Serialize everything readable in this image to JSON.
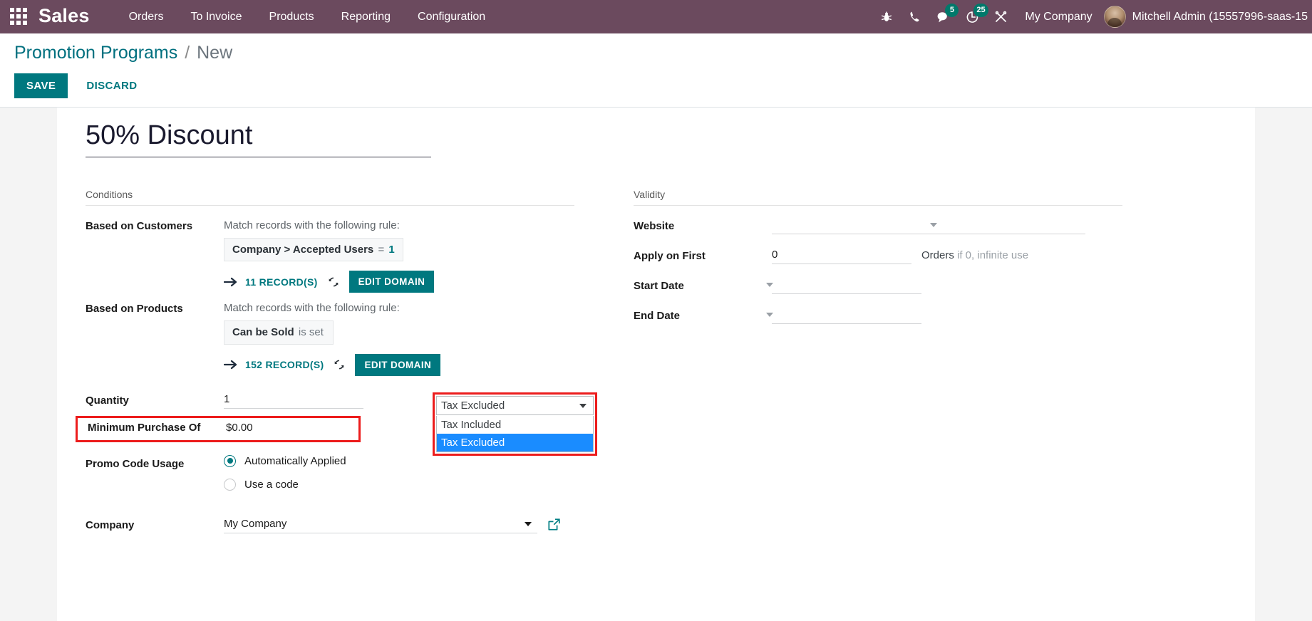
{
  "navbar": {
    "brand": "Sales",
    "apps_icon": "apps-grid-icon",
    "menus": [
      {
        "label": "Orders"
      },
      {
        "label": "To Invoice"
      },
      {
        "label": "Products"
      },
      {
        "label": "Reporting"
      },
      {
        "label": "Configuration"
      }
    ],
    "sys_icons": [
      {
        "name": "bug-icon",
        "badge": ""
      },
      {
        "name": "phone-icon",
        "badge": ""
      },
      {
        "name": "messages-icon",
        "badge": "5"
      },
      {
        "name": "activities-clock-icon",
        "badge": "25"
      },
      {
        "name": "tools-icon",
        "badge": ""
      }
    ],
    "company": "My Company",
    "user": "Mitchell Admin (15557996-saas-15"
  },
  "control_panel": {
    "breadcrumb_root": "Promotion Programs",
    "breadcrumb_sep": "/",
    "breadcrumb_current": "New",
    "save_label": "SAVE",
    "discard_label": "DISCARD"
  },
  "record": {
    "title": "50% Discount"
  },
  "conditions": {
    "group_title": "Conditions",
    "based_on_customers": {
      "label": "Based on Customers",
      "hint": "Match records with the following rule:",
      "chip_field": "Company > Accepted Users",
      "chip_operator": "=",
      "chip_value": "1",
      "records_count": "11 RECORD(S)",
      "edit_domain_label": "EDIT DOMAIN"
    },
    "based_on_products": {
      "label": "Based on Products",
      "hint": "Match records with the following rule:",
      "chip_field": "Can be Sold",
      "chip_operator": "is set",
      "chip_value": "",
      "records_count": "152 RECORD(S)",
      "edit_domain_label": "EDIT DOMAIN"
    },
    "quantity": {
      "label": "Quantity",
      "value": "1"
    },
    "minimum_purchase": {
      "label": "Minimum Purchase Of",
      "value": "$0.00"
    },
    "tax_select": {
      "selected": "Tax Excluded",
      "options": [
        {
          "label": "Tax Included",
          "selected": false
        },
        {
          "label": "Tax Excluded",
          "selected": true
        }
      ]
    },
    "promo_code_usage": {
      "label": "Promo Code Usage",
      "option_auto": "Automatically Applied",
      "option_code": "Use a code"
    },
    "company": {
      "label": "Company",
      "value": "My Company",
      "external_link_icon": "external-link-icon"
    }
  },
  "validity": {
    "group_title": "Validity",
    "website": {
      "label": "Website",
      "value": ""
    },
    "apply_on_first": {
      "label": "Apply on First",
      "value": "0",
      "unit_strong": "Orders",
      "unit_light": "if 0, infinite use"
    },
    "start_date": {
      "label": "Start Date",
      "value": ""
    },
    "end_date": {
      "label": "End Date",
      "value": ""
    }
  },
  "colors": {
    "navbar_bg": "#6b4a5e",
    "accent_teal": "#00787f",
    "badge_teal": "#00796b",
    "highlight_red": "#ec1c1c",
    "option_highlight_blue": "#1a8cff"
  }
}
